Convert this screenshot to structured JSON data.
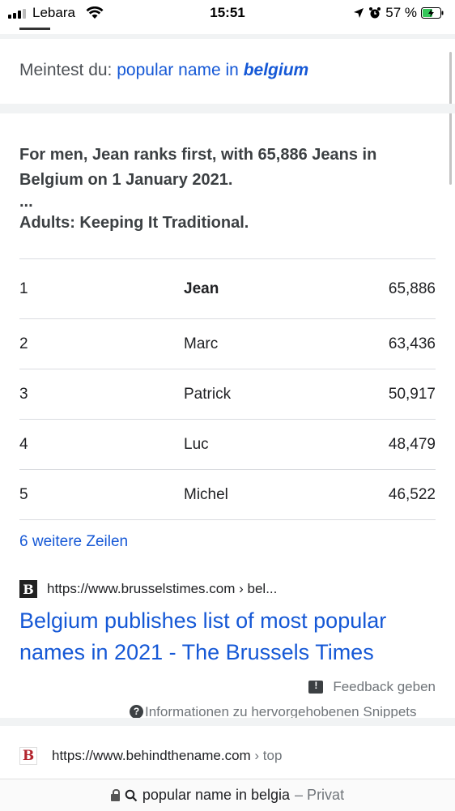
{
  "status_bar": {
    "carrier": "Lebara",
    "time": "15:51",
    "battery": "57 %",
    "icons": [
      "signal-icon",
      "wifi-icon",
      "location-arrow-icon",
      "alarm-icon",
      "battery-charging-icon"
    ]
  },
  "did_you_mean": {
    "prefix": "Meintest du:",
    "query_plain": "popular name in",
    "query_emphasis": "belgium"
  },
  "snippet": {
    "line1": "For men, Jean ranks first, with 65,886 Jeans in Belgium on 1 January 2021.",
    "ellipsis": "...",
    "line2": "Adults: Keeping It Traditional."
  },
  "table": {
    "rows": [
      {
        "rank": "1",
        "name": "Jean",
        "count": "65,886"
      },
      {
        "rank": "2",
        "name": "Marc",
        "count": "63,436"
      },
      {
        "rank": "3",
        "name": "Patrick",
        "count": "50,917"
      },
      {
        "rank": "4",
        "name": "Luc",
        "count": "48,479"
      },
      {
        "rank": "5",
        "name": "Michel",
        "count": "46,522"
      }
    ],
    "more_rows": "6 weitere Zeilen"
  },
  "result1": {
    "favicon_letter": "B",
    "url": "https://www.brusselstimes.com › bel...",
    "title": "Belgium publishes list of most popular names in 2021 - The Brussels Times"
  },
  "feedback": {
    "label": "Feedback geben",
    "info": "Informationen zu hervorgehobenen Snippets"
  },
  "result2": {
    "favicon_letter": "B",
    "url": "https://www.behindthename.com",
    "crumb": "› top"
  },
  "url_bar": {
    "query": "popular name in belgia",
    "mode": "– Privat"
  },
  "colors": {
    "link": "#1558d6",
    "band": "#f1f3f4"
  }
}
